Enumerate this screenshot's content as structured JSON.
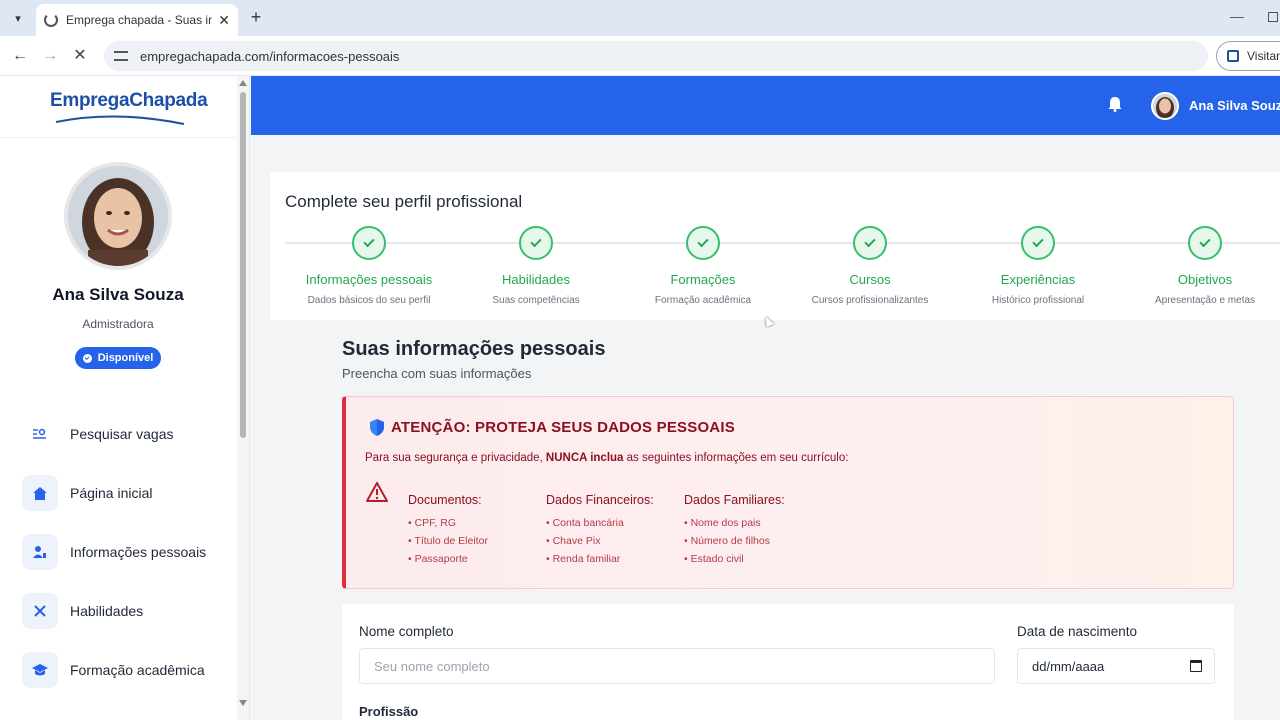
{
  "browser": {
    "tab_title": "Emprega chapada - Suas inform",
    "url": "empregachapada.com/informacoes-pessoais",
    "profile_label": "Visitan"
  },
  "sidebar": {
    "logo": "EmpregaChapada",
    "user_name": "Ana Silva Souza",
    "user_role": "Admistradora",
    "status": "Disponível",
    "items": [
      {
        "label": "Pesquisar vagas",
        "icon": "search-list-icon"
      },
      {
        "label": "Página inicial",
        "icon": "home-icon"
      },
      {
        "label": "Informações pessoais",
        "icon": "user-edit-icon"
      },
      {
        "label": "Habilidades",
        "icon": "tools-icon"
      },
      {
        "label": "Formação acadêmica",
        "icon": "graduation-cap-icon"
      }
    ]
  },
  "header": {
    "user_name": "Ana Silva Souza"
  },
  "progress": {
    "title": "Complete seu perfil profissional",
    "steps": [
      {
        "title": "Informações pessoais",
        "desc": "Dados básicos do seu perfil"
      },
      {
        "title": "Habilidades",
        "desc": "Suas competências"
      },
      {
        "title": "Formações",
        "desc": "Formação acadêmica"
      },
      {
        "title": "Cursos",
        "desc": "Cursos profissionalizantes"
      },
      {
        "title": "Experiências",
        "desc": "Histórico profissional"
      },
      {
        "title": "Objetivos",
        "desc": "Apresentação e metas"
      }
    ]
  },
  "section": {
    "title": "Suas informações pessoais",
    "subtitle": "Preencha com suas informações"
  },
  "warning": {
    "title": "ATENÇÃO: PROTEJA SEUS DADOS PESSOAIS",
    "text_before": "Para sua segurança e privacidade, ",
    "text_bold": "NUNCA inclua",
    "text_after": " as seguintes informações em seu currículo:",
    "columns": [
      {
        "title": "Documentos:",
        "items": [
          "• CPF, RG",
          "• Título de Eleitor",
          "• Passaporte"
        ]
      },
      {
        "title": "Dados Financeiros:",
        "items": [
          "• Conta bancária",
          "• Chave Pix",
          "• Renda familiar"
        ]
      },
      {
        "title": "Dados Familiares:",
        "items": [
          "• Nome dos pais",
          "• Número de filhos",
          "• Estado civil"
        ]
      }
    ]
  },
  "form": {
    "name_label": "Nome completo",
    "name_placeholder": "Seu nome completo",
    "birth_label": "Data de nascimento",
    "birth_placeholder": "dd/mm/aaaa",
    "profession_label": "Profissão"
  },
  "colors": {
    "primary": "#2563eb",
    "success": "#22a652",
    "danger": "#dc2d3d"
  }
}
